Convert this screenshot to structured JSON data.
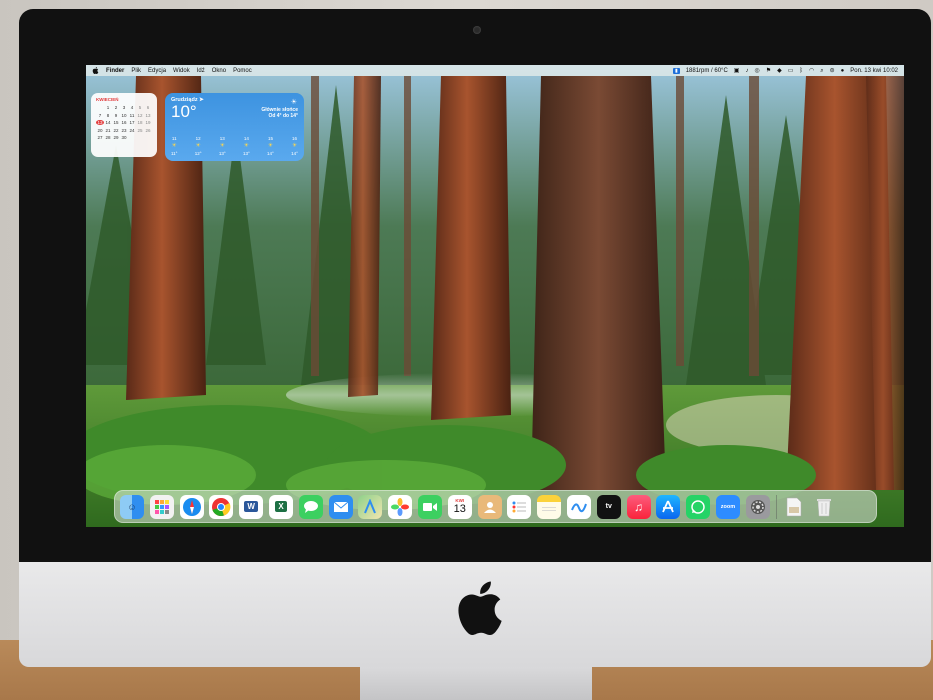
{
  "menubar": {
    "app_name": "Finder",
    "items": [
      "Plik",
      "Edycja",
      "Widok",
      "Idź",
      "Okno",
      "Pomoc"
    ],
    "stats_text": "1881rpm / 60°C",
    "datetime": "Pon. 13 kwi  10:02"
  },
  "calendar_widget": {
    "month": "KWIECIEŃ",
    "rows": [
      [
        "",
        "1",
        "2",
        "3",
        "4",
        "5",
        "6"
      ],
      [
        "7",
        "8",
        "9",
        "10",
        "11",
        "12",
        "13"
      ],
      [
        "13",
        "14",
        "15",
        "16",
        "17",
        "18",
        "19"
      ],
      [
        "20",
        "21",
        "22",
        "23",
        "24",
        "25",
        "26"
      ],
      [
        "27",
        "28",
        "29",
        "30",
        "",
        "",
        ""
      ]
    ],
    "today": "13"
  },
  "weather_widget": {
    "city": "Grudziądz ➤",
    "temp": "10°",
    "condition_line1": "Głównie słońce",
    "condition_line2": "Od 4° do 14°",
    "forecast": [
      {
        "hour": "11",
        "temp": "11°"
      },
      {
        "hour": "12",
        "temp": "12°"
      },
      {
        "hour": "13",
        "temp": "13°"
      },
      {
        "hour": "14",
        "temp": "13°"
      },
      {
        "hour": "15",
        "temp": "14°"
      },
      {
        "hour": "16",
        "temp": "14°"
      }
    ]
  },
  "dock": {
    "calendar_month": "KWI",
    "calendar_day": "13",
    "appletv_label": "tv",
    "zoom_label": "zoom",
    "word_label": "W",
    "excel_label": "X",
    "apps": [
      "finder",
      "launchpad",
      "safari",
      "chrome",
      "word",
      "excel",
      "messages",
      "mail",
      "maps",
      "photos",
      "facetime",
      "calendar",
      "contacts",
      "reminders",
      "notes",
      "freeform",
      "appletv",
      "music",
      "appstore",
      "whatsapp",
      "zoom",
      "settings",
      "downloads",
      "trash"
    ]
  },
  "colors": {
    "menubar_bg": "#ebf0eb",
    "today_red": "#e23b3b",
    "weather_blue": "#3d93e0"
  }
}
